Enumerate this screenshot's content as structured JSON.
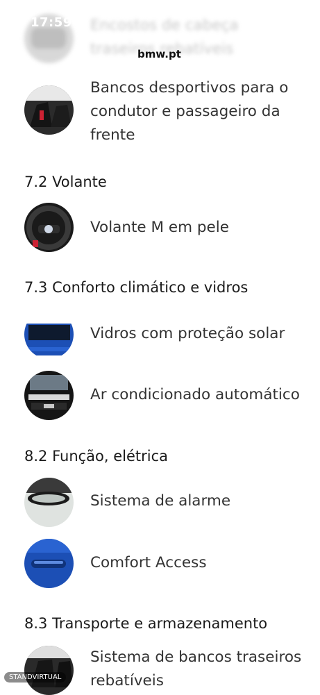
{
  "status_bar": {
    "time": "17:59"
  },
  "header": {
    "site": "bmw.pt"
  },
  "items": [
    {
      "label": "Encostos de cabeça traseiros rebatíveis",
      "icon": "headrest-photo-icon"
    },
    {
      "label": "Bancos desportivos para o condutor e passageiro da frente",
      "icon": "sport-seats-photo-icon"
    },
    {
      "label": "Volante M em pele",
      "icon": "steering-wheel-photo-icon"
    },
    {
      "label": "Vidros com proteção solar",
      "icon": "tinted-window-photo-icon"
    },
    {
      "label": "Ar condicionado automático",
      "icon": "climate-control-photo-icon"
    },
    {
      "label": "Sistema de alarme",
      "icon": "alarm-mirror-photo-icon"
    },
    {
      "label": "Comfort Access",
      "icon": "door-handle-photo-icon"
    },
    {
      "label": "Sistema de bancos traseiros rebatíveis",
      "icon": "rear-seats-photo-icon"
    }
  ],
  "sections": [
    {
      "title": "7.2 Volante"
    },
    {
      "title": "7.3 Conforto climático e vidros"
    },
    {
      "title": "8.2 Função, elétrica"
    },
    {
      "title": "8.3 Transporte e armazenamento"
    }
  ],
  "watermark": {
    "text": "STANDVIRTUAL"
  },
  "colors": {
    "text": "#333333",
    "background": "#ffffff",
    "bmw_blue": "#1c4fb5"
  }
}
